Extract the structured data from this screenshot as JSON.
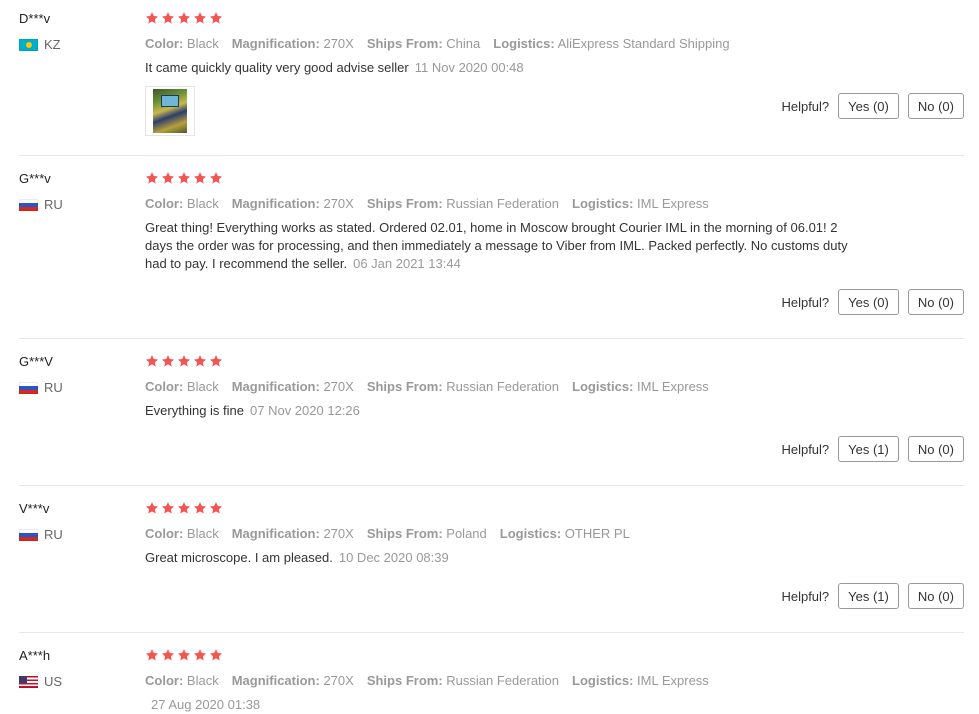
{
  "labels": {
    "color": "Color:",
    "magnification": "Magnification:",
    "ships_from": "Ships From:",
    "logistics": "Logistics:",
    "helpful": "Helpful?"
  },
  "colors": {
    "star": "#f4544f",
    "attr_label": "#999999",
    "flag_kz": "#00afca"
  },
  "reviews": [
    {
      "user": "D***v",
      "country": "KZ",
      "flag": "flag-kz",
      "rating": 5,
      "color": "Black",
      "magnification": "270X",
      "ships_from": "China",
      "logistics": "AliExpress Standard Shipping",
      "text": "It came quickly quality very good advise seller",
      "date": "11 Nov 2020 00:48",
      "has_photo": true,
      "yes": "Yes (0)",
      "no": "No (0)"
    },
    {
      "user": "G***v",
      "country": "RU",
      "flag": "flag-ru",
      "rating": 5,
      "color": "Black",
      "magnification": "270X",
      "ships_from": "Russian Federation",
      "logistics": "IML Express",
      "text": "Great thing! Everything works as stated. Ordered 02.01, home in Moscow brought Courier IML in the morning of 06.01! 2 days the order was for processing, and then immediately a message to Viber from IML. Packed perfectly. No customs duty had to pay. I recommend the seller.",
      "date": "06 Jan 2021 13:44",
      "yes": "Yes (0)",
      "no": "No (0)"
    },
    {
      "user": "G***V",
      "country": "RU",
      "flag": "flag-ru",
      "rating": 5,
      "color": "Black",
      "magnification": "270X",
      "ships_from": "Russian Federation",
      "logistics": "IML Express",
      "text": "Everything is fine",
      "date": "07 Nov 2020 12:26",
      "yes": "Yes (1)",
      "no": "No (0)"
    },
    {
      "user": "V***v",
      "country": "RU",
      "flag": "flag-ru",
      "rating": 5,
      "color": "Black",
      "magnification": "270X",
      "ships_from": "Poland",
      "logistics": "OTHER PL",
      "text": "Great microscope. I am pleased.",
      "date": "10 Dec 2020 08:39",
      "yes": "Yes (1)",
      "no": "No (0)"
    },
    {
      "user": "A***h",
      "country": "US",
      "flag": "flag-us",
      "rating": 5,
      "color": "Black",
      "magnification": "270X",
      "ships_from": "Russian Federation",
      "logistics": "IML Express",
      "text": "",
      "date": "27 Aug 2020 01:38"
    }
  ]
}
